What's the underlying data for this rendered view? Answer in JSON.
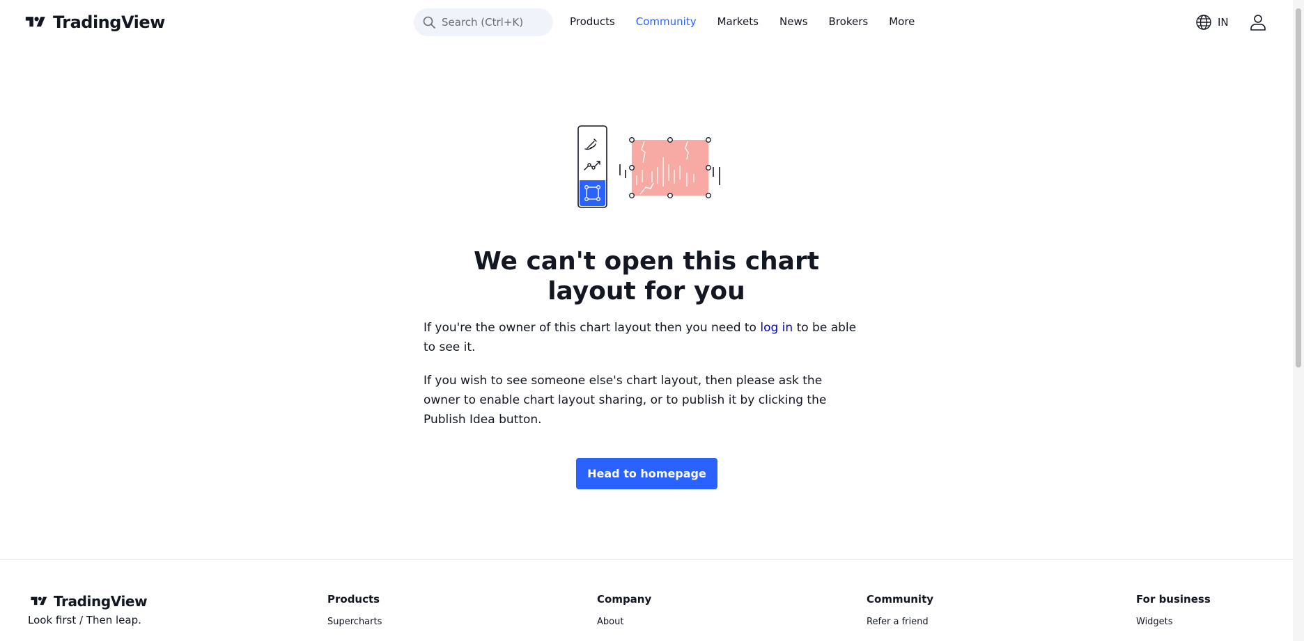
{
  "header": {
    "logo_text": "TradingView",
    "search_placeholder": "Search (Ctrl+K)",
    "nav": [
      "Products",
      "Community",
      "Markets",
      "News",
      "Brokers",
      "More"
    ],
    "active_nav": "Community",
    "language": "IN"
  },
  "main": {
    "title": "We can't open this chart layout for you",
    "p1_before": "If you're the owner of this chart layout then you need to ",
    "p1_link": "log in",
    "p1_after": " to be able to see it.",
    "p2": "If you wish to see someone else's chart layout, then please ask the owner to enable chart layout sharing, or to publish it by clicking the Publish Idea button.",
    "button_label": "Head to homepage"
  },
  "footer": {
    "logo_text": "TradingView",
    "tagline": "Look first / Then leap.",
    "columns": [
      {
        "heading": "Products",
        "links": [
          "Supercharts"
        ]
      },
      {
        "heading": "Company",
        "links": [
          "About"
        ]
      },
      {
        "heading": "Community",
        "links": [
          "Refer a friend"
        ]
      },
      {
        "heading": "For business",
        "links": [
          "Widgets"
        ]
      }
    ]
  },
  "colors": {
    "accent": "#2962ff",
    "link": "#0000cc",
    "illustration_fill": "#f7a9a3",
    "text": "#131722"
  },
  "icons": [
    "tradingview-logo-icon",
    "search-icon",
    "globe-icon",
    "user-icon",
    "brush-icon",
    "trend-line-icon",
    "rectangle-select-icon"
  ]
}
